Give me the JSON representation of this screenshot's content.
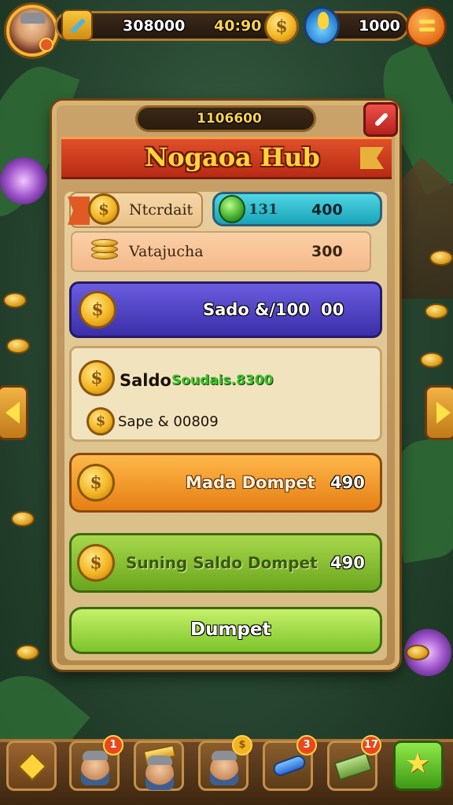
{
  "top_bar": {
    "gold_amount": "308000",
    "timer": "40:90",
    "gem_amount": "1000"
  },
  "panel": {
    "top_readout": "1106600",
    "title": "Nogaoa Hub",
    "row1": {
      "label": "Ntcrdait",
      "value_label": "131",
      "value": "400"
    },
    "row2": {
      "label": "Vatajucha",
      "value": "300"
    },
    "row3": {
      "label": "Sado &/100",
      "value": "00"
    },
    "row4": {
      "label": "Saldo",
      "sub_label": "Soudais.8300",
      "label2": "Sape & 00809"
    },
    "row5": {
      "label": "Mada Dompet",
      "value": "490"
    },
    "row6": {
      "label": "Suning Saldo Dompet",
      "value": "490"
    },
    "row7": {
      "label": "Dumpet"
    }
  },
  "bottom_bar": {
    "slots": [
      {
        "name": "back",
        "badge": ""
      },
      {
        "name": "character-1",
        "badge": "1"
      },
      {
        "name": "gold-bar",
        "badge": ""
      },
      {
        "name": "character-2",
        "badge": ""
      },
      {
        "name": "scroll",
        "badge": "3"
      },
      {
        "name": "cash",
        "badge": "17"
      },
      {
        "name": "star",
        "badge": ""
      }
    ]
  },
  "colors": {
    "accent_gold": "#f3b522",
    "panel_bg": "#e6cf9e",
    "title_red": "#c8361a",
    "row_purple": "#4a3cc0",
    "row_orange": "#f29a2a",
    "row_green": "#7cbc2a",
    "row_cyan": "#2cc0d0"
  },
  "icons": [
    "avatar",
    "pencil-icon",
    "coin-icon",
    "gem-icon",
    "menu-icon",
    "close-icon",
    "flag-icon",
    "drop-icon",
    "coin-stack-icon",
    "arrow-left-icon",
    "arrow-right-icon",
    "star-icon"
  ]
}
